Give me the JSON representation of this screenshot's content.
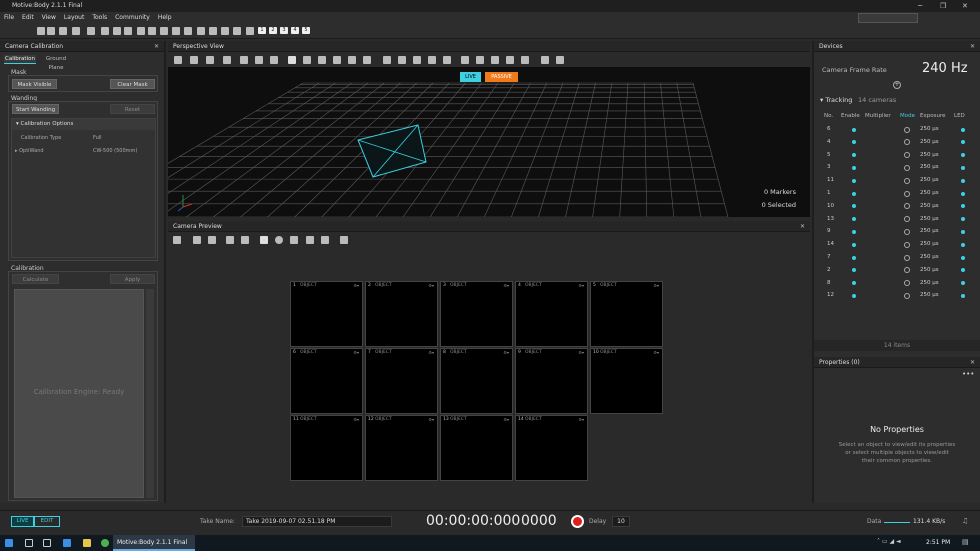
{
  "app": {
    "title": "Motive:Body 2.1.1 Final"
  },
  "menu": [
    "File",
    "Edit",
    "View",
    "Layout",
    "Tools",
    "Community",
    "Help"
  ],
  "toolbar": {
    "layout_buttons": [
      "1",
      "2",
      "3",
      "4",
      "5"
    ]
  },
  "calibration_panel": {
    "title": "Camera Calibration",
    "tabs": [
      "Calibration",
      "Ground Plane"
    ],
    "mask": {
      "label": "Mask",
      "mask_visible": "Mask Visible",
      "clear_mask": "Clear Mask"
    },
    "wanding": {
      "label": "Wanding",
      "start": "Start Wanding",
      "reset": "Reset"
    },
    "options": {
      "header": "Calibration Options",
      "type_label": "Calibration Type",
      "type_value": "Full",
      "wand_label": "OptiWand",
      "wand_value": "CW-500 (500mm)"
    },
    "calibration": {
      "label": "Calibration",
      "calculate": "Calculate",
      "apply": "Apply",
      "status": "Calibration Engine: Ready"
    }
  },
  "perspective": {
    "title": "Perspective View",
    "buttons": {
      "live": "LIVE",
      "passive": "PASSIVE"
    },
    "markers": "0 Markers",
    "selected": "0 Selected"
  },
  "preview": {
    "title": "Camera Preview",
    "cameras": [
      {
        "n": "1",
        "m": "OBJECT"
      },
      {
        "n": "2",
        "m": "OBJECT"
      },
      {
        "n": "3",
        "m": "OBJECT"
      },
      {
        "n": "4",
        "m": "OBJECT"
      },
      {
        "n": "5",
        "m": "OBJECT"
      },
      {
        "n": "6",
        "m": "OBJECT"
      },
      {
        "n": "7",
        "m": "OBJECT"
      },
      {
        "n": "8",
        "m": "OBJECT"
      },
      {
        "n": "9",
        "m": "OBJECT"
      },
      {
        "n": "10",
        "m": "OBJECT"
      },
      {
        "n": "11",
        "m": "OBJECT"
      },
      {
        "n": "12",
        "m": "OBJECT"
      },
      {
        "n": "13",
        "m": "OBJECT"
      },
      {
        "n": "14",
        "m": "OBJECT"
      }
    ]
  },
  "devices": {
    "title": "Devices",
    "frame_rate_label": "Camera Frame Rate",
    "frame_rate": "240 Hz",
    "tracking_label": "Tracking",
    "tracking_count": "14 cameras",
    "columns": [
      "No.",
      "Enable",
      "Multiplier",
      "Mode",
      "Exposure",
      "LED"
    ],
    "rows": [
      {
        "no": "6",
        "exp": "250 µs"
      },
      {
        "no": "4",
        "exp": "250 µs"
      },
      {
        "no": "5",
        "exp": "250 µs"
      },
      {
        "no": "3",
        "exp": "250 µs"
      },
      {
        "no": "11",
        "exp": "250 µs"
      },
      {
        "no": "1",
        "exp": "250 µs"
      },
      {
        "no": "10",
        "exp": "250 µs"
      },
      {
        "no": "13",
        "exp": "250 µs"
      },
      {
        "no": "9",
        "exp": "250 µs"
      },
      {
        "no": "14",
        "exp": "250 µs"
      },
      {
        "no": "7",
        "exp": "250 µs"
      },
      {
        "no": "2",
        "exp": "250 µs"
      },
      {
        "no": "8",
        "exp": "250 µs"
      },
      {
        "no": "12",
        "exp": "250 µs"
      }
    ],
    "footer": "14 items"
  },
  "properties": {
    "title": "Properties (0)",
    "heading": "No Properties",
    "line1": "Select an object to view/edit its properties",
    "line2": "or select multiple objects to view/edit",
    "line3": "their common properties."
  },
  "bottom": {
    "live": "LIVE",
    "edit": "EDIT",
    "take_label": "Take Name:",
    "take_value": "Take 2019-09-07 02.51.18 PM",
    "timecode": "00:00:00:000",
    "frame": "0000",
    "delay_label": "Delay",
    "delay_value": "10",
    "data_label": "Data",
    "data_rate": "131.4 KB/s"
  },
  "taskbar": {
    "app": "Motive:Body 2.1.1 Final",
    "time": "2:51 PM"
  },
  "colors": {
    "accent": "#3dd0e0",
    "passive": "#f07a1a",
    "record": "#e01e1e"
  }
}
